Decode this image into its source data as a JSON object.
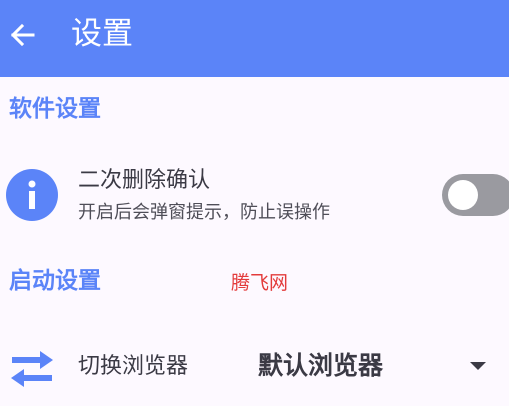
{
  "colors": {
    "primary": "#5b84f8",
    "background": "#fdf9ff",
    "toggle_off": "#9a9aa0",
    "watermark": "#e33b3b"
  },
  "appbar": {
    "back_icon": "arrow-back-icon",
    "title": "设置"
  },
  "sections": {
    "software": {
      "title": "软件设置",
      "delete_confirm": {
        "icon": "info-icon",
        "title": "二次删除确认",
        "description": "开启后会弹窗提示，防止误操作",
        "enabled": false
      }
    },
    "startup": {
      "title": "启动设置",
      "browser": {
        "icon": "swap-icon",
        "label": "切换浏览器",
        "value": "默认浏览器"
      }
    }
  },
  "watermark": "腾飞网"
}
